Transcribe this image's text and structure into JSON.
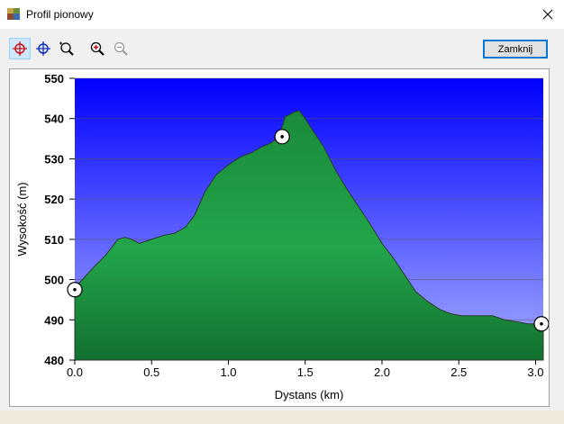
{
  "window": {
    "title": "Profil pionowy",
    "icons": {
      "app": "profile-map-icon",
      "close": "close-icon"
    }
  },
  "toolbar": {
    "tools": [
      "crosshair-red-icon",
      "crosshair-blue-icon",
      "zoom-region-icon",
      "zoom-in-icon",
      "zoom-out-icon"
    ],
    "active_tool": "crosshair-red-icon",
    "close_label": "Zamknij"
  },
  "chart_data": {
    "type": "area",
    "xlabel": "Dystans  (km)",
    "ylabel": "Wysokość (m)",
    "xlim": [
      0,
      3.05
    ],
    "ylim": [
      480,
      550
    ],
    "xticks": [
      0.0,
      0.5,
      1.0,
      1.5,
      2.0,
      2.5,
      3.0
    ],
    "yticks": [
      480,
      490,
      500,
      510,
      520,
      530,
      540,
      550
    ],
    "grid": true,
    "colors": {
      "fill": "#1f9e45",
      "fill_dark": "#1a7d39",
      "sky_top": "#0000ff",
      "sky_bottom": "#9aa3ff",
      "grid": "#555555"
    },
    "x": [
      0.0,
      0.05,
      0.12,
      0.2,
      0.28,
      0.33,
      0.37,
      0.42,
      0.5,
      0.58,
      0.65,
      0.72,
      0.78,
      0.85,
      0.92,
      1.0,
      1.08,
      1.15,
      1.22,
      1.28,
      1.33,
      1.37,
      1.4,
      1.42,
      1.46,
      1.5,
      1.55,
      1.62,
      1.7,
      1.78,
      1.85,
      1.92,
      2.0,
      2.08,
      2.15,
      2.22,
      2.3,
      2.38,
      2.45,
      2.52,
      2.58,
      2.65,
      2.72,
      2.8,
      2.88,
      2.95,
      3.05
    ],
    "y": [
      498.0,
      500.0,
      503.0,
      506.0,
      510.0,
      510.5,
      510.0,
      509.0,
      510.0,
      511.0,
      511.5,
      513.0,
      516.0,
      522.0,
      526.0,
      528.5,
      530.5,
      531.5,
      533.0,
      534.0,
      535.5,
      540.5,
      541.0,
      541.5,
      542.0,
      540.0,
      537.0,
      533.0,
      527.0,
      522.0,
      518.0,
      514.0,
      509.0,
      505.0,
      501.0,
      497.0,
      494.5,
      492.5,
      491.5,
      491.0,
      491.0,
      491.0,
      491.0,
      490.0,
      489.5,
      489.0,
      489.0
    ],
    "markers": [
      {
        "x": 0.0,
        "y": 497.5
      },
      {
        "x": 1.35,
        "y": 535.5
      },
      {
        "x": 3.05,
        "y": 489.0
      }
    ]
  }
}
